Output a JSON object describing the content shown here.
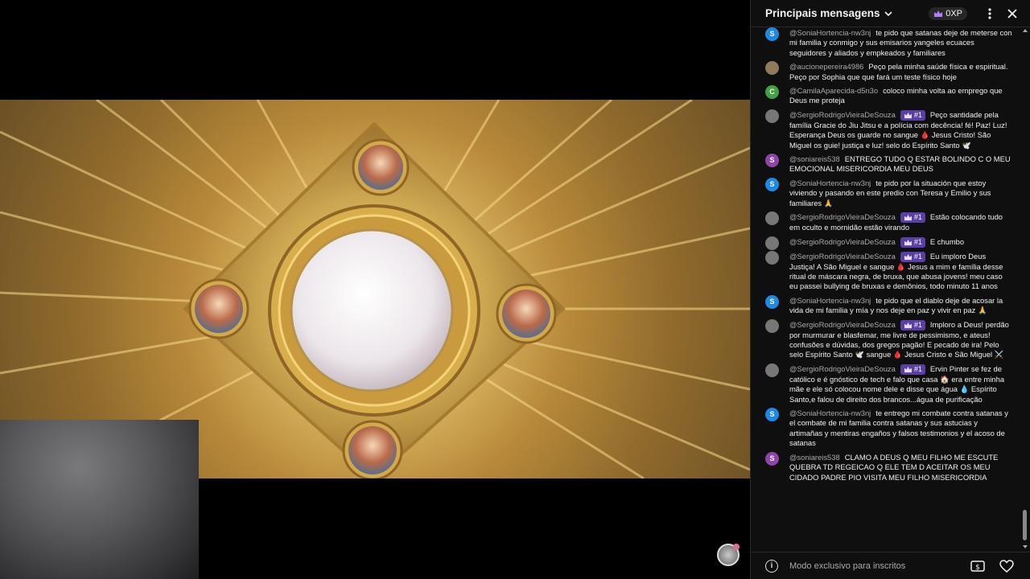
{
  "chat": {
    "title": "Principais mensagens",
    "xp": "0XP",
    "footer_text": "Modo exclusivo para inscritos",
    "badge_label": "#1",
    "messages": [
      {
        "avatar_letter": "S",
        "avatar_color": "#1e88e5",
        "author": "@SoniaHortencia-nw3nj",
        "text": "te pido que satanas deje de meterse con mi familia y conmigo y sus emisarios yangeles ecuaces seguidores y aliados y empkeados y familiares",
        "badge": false
      },
      {
        "avatar_letter": "",
        "avatar_color": "#8d7b5c",
        "author": "@aucionepereira4986",
        "text": "Peço pela minha saúde física e espiritual. Peço por Sophia que que fará um teste físico hoje",
        "badge": false
      },
      {
        "avatar_letter": "C",
        "avatar_color": "#43a047",
        "author": "@CamilaAparecida-d5n3o",
        "text": "coloco minha volta ao emprego que Deus me proteja",
        "badge": false
      },
      {
        "avatar_letter": "",
        "avatar_color": "#777",
        "author": "@SergioRodrigoVieiraDeSouza",
        "text": "Peço santidade pela família Gracie do Jiu Jitsu e a polícia com decência! fé! Paz! Luz! Esperança Deus os guarde no sangue 🩸 Jesus Cristo! São Miguel os guie! justiça e luz! selo do Espírito Santo 🕊️",
        "badge": true
      },
      {
        "avatar_letter": "S",
        "avatar_color": "#8e44ad",
        "author": "@soniareis538",
        "text": "ENTREGO TUDO Q ESTAR BOLINDO C O MEU EMOCIONAL MISERICORDIA MEU DEUS",
        "badge": false
      },
      {
        "avatar_letter": "S",
        "avatar_color": "#1e88e5",
        "author": "@SoniaHortencia-nw3nj",
        "text": "te pido por la situación que estoy viviendo y pasando en este predio con Teresa y Emilio y sus familiares 🙏",
        "badge": false
      },
      {
        "avatar_letter": "",
        "avatar_color": "#777",
        "author": "@SergioRodrigoVieiraDeSouza",
        "text": "Estão colocando tudo em oculto e mornidão estão virando",
        "badge": true
      },
      {
        "avatar_letter": "",
        "avatar_color": "#777",
        "author": "@SergioRodrigoVieiraDeSouza",
        "text": "E chumbo",
        "badge": true
      },
      {
        "avatar_letter": "",
        "avatar_color": "#777",
        "author": "@SergioRodrigoVieiraDeSouza",
        "text": "Eu imploro Deus Justiça! A São Miguel e sangue 🩸 Jesus a mim e família desse ritual de máscara negra, de bruxa, que abusa jovens! meu caso eu passei bullying de bruxas e demônios, todo minuto 11 anos",
        "badge": true
      },
      {
        "avatar_letter": "S",
        "avatar_color": "#1e88e5",
        "author": "@SoniaHortencia-nw3nj",
        "text": "te pido que el diablo deje de acosar la vida de mi familia y mía y nos deje en paz y vivir en paz 🙏",
        "badge": false
      },
      {
        "avatar_letter": "",
        "avatar_color": "#777",
        "author": "@SergioRodrigoVieiraDeSouza",
        "text": "Imploro a Deus! perdão por murmurar e blasfemar, me livre de pessimismo, e ateus! confusões e dúvidas, dos gregos pagão! E pecado de ira! Pelo selo Espírito Santo 🕊️ sangue 🩸 Jesus Cristo e São Miguel ⚔️",
        "badge": true
      },
      {
        "avatar_letter": "",
        "avatar_color": "#777",
        "author": "@SergioRodrigoVieiraDeSouza",
        "text": "Ervin Pinter se fez de católico e é gnóstico de tech e falo que casa 🏠 era entre minha mãe e ele só colocou nome dele e disse que água 💧 Espírito Santo,e falou de direito dos brancos...água de purificação",
        "badge": true
      },
      {
        "avatar_letter": "S",
        "avatar_color": "#1e88e5",
        "author": "@SoniaHortencia-nw3nj",
        "text": "te entrego mi combate contra satanas y el combate de mi familia contra satanas y sus astucias y artimañas y mentiras engaños y falsos testimonios y el acoso de satanas",
        "badge": false
      },
      {
        "avatar_letter": "S",
        "avatar_color": "#8e44ad",
        "author": "@soniareis538",
        "text": "CLAMO A DEUS Q MEU FILHO ME ESCUTE QUEBRA TD REGEICAO Q ELE TEM D ACEITAR OS MEU CIDADO PADRE PIO VISITA MEU FILHO MISERICORDIA",
        "badge": false
      }
    ]
  }
}
